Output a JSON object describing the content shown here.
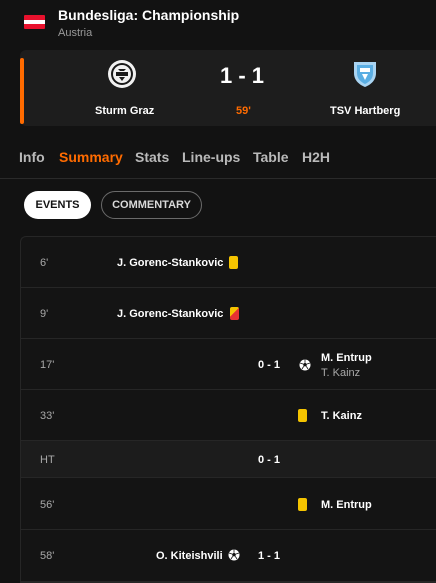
{
  "competition": {
    "title": "Bundesliga: Championship",
    "country": "Austria"
  },
  "match": {
    "home_team": "Sturm Graz",
    "away_team": "TSV Hartberg",
    "score": "1 - 1",
    "minute": "59'"
  },
  "tabs": [
    "Info",
    "Summary",
    "Stats",
    "Line-ups",
    "Table",
    "H2H"
  ],
  "active_tab": "Summary",
  "toggles": {
    "events": "EVENTS",
    "commentary": "COMMENTARY"
  },
  "events": [
    {
      "minute": "6'",
      "player": "J. Gorenc-Stankovic",
      "type": "yellow-card"
    },
    {
      "minute": "9'",
      "player": "J. Gorenc-Stankovic",
      "type": "second-yellow-card"
    },
    {
      "minute": "17'",
      "score": "0 - 1",
      "player": "M. Entrup",
      "assist": "T. Kainz",
      "type": "goal"
    },
    {
      "minute": "33'",
      "player": "T. Kainz",
      "type": "yellow-card"
    },
    {
      "minute": "HT",
      "score": "0 - 1",
      "type": "half-time"
    },
    {
      "minute": "56'",
      "player": "M. Entrup",
      "type": "yellow-card"
    },
    {
      "minute": "58'",
      "player": "O. Kiteishvili",
      "score": "1 - 1",
      "type": "goal"
    }
  ],
  "colors": {
    "accent": "#ff6b00",
    "yellow_card": "#f5c400",
    "red_card": "#e63333",
    "background": "#121212",
    "panel": "#1d1d1d"
  },
  "icons": {
    "flag": "austria-flag-icon",
    "home_crest": "sturm-graz-crest-icon",
    "away_crest": "tsv-hartberg-crest-icon",
    "goal": "football-icon",
    "card": "card-icon"
  }
}
